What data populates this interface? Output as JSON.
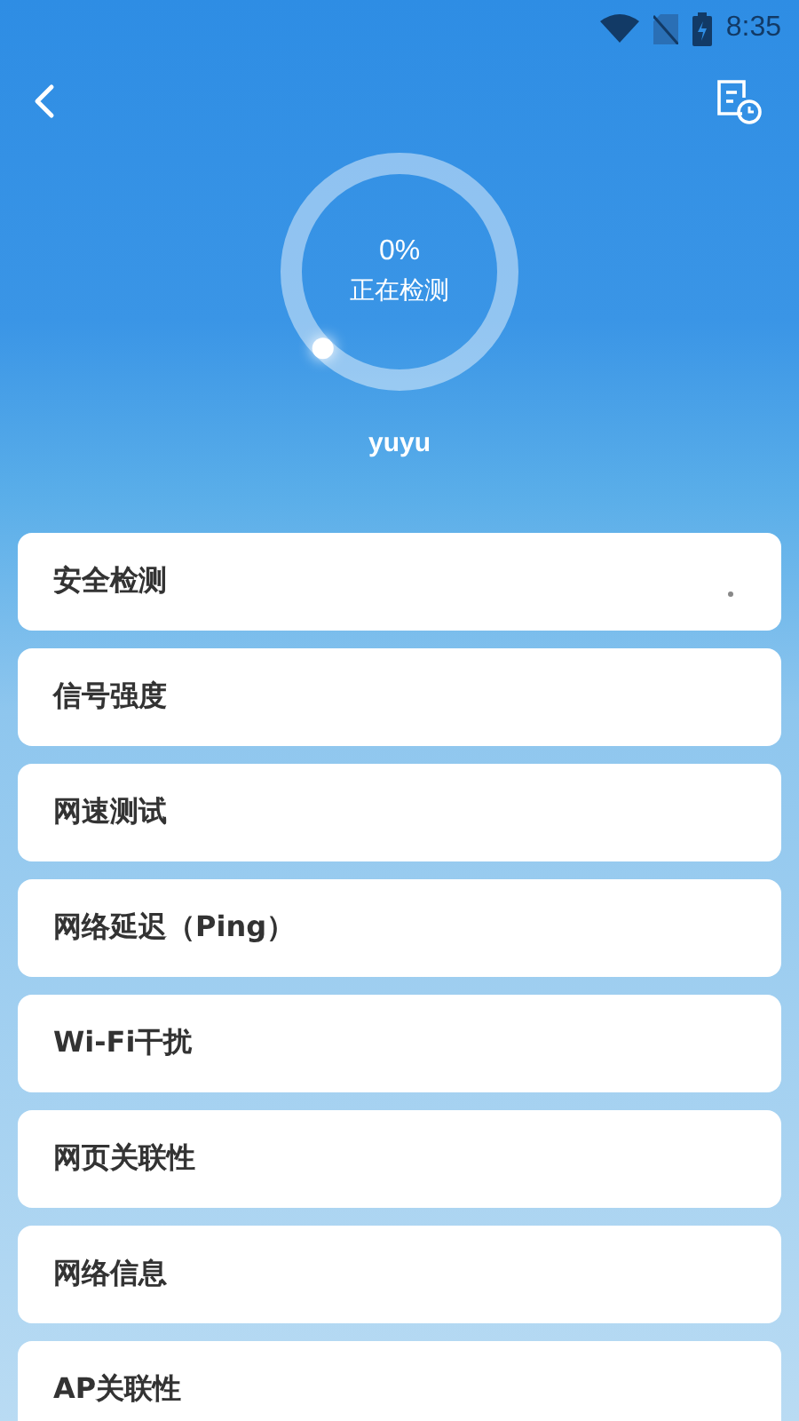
{
  "status_bar": {
    "time": "8:35"
  },
  "progress": {
    "percent": "0%",
    "label": "正在检测",
    "level": 0
  },
  "network_name": "yuyu",
  "items": [
    {
      "label": "安全检测",
      "loading": true
    },
    {
      "label": "信号强度",
      "loading": false
    },
    {
      "label": "网速测试",
      "loading": false
    },
    {
      "label": "网络延迟（Ping）",
      "loading": false
    },
    {
      "label": "Wi-Fi干扰",
      "loading": false
    },
    {
      "label": "网页关联性",
      "loading": false
    },
    {
      "label": "网络信息",
      "loading": false
    },
    {
      "label": "AP关联性",
      "loading": false
    }
  ]
}
